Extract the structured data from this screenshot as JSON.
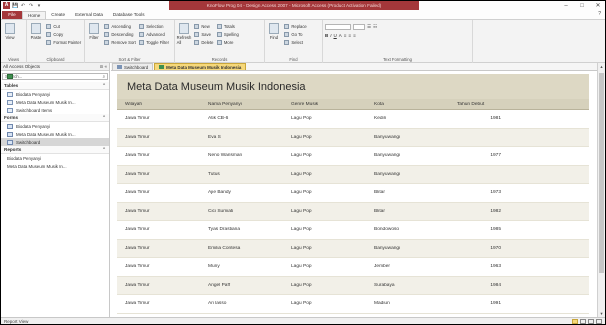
{
  "title_bar": {
    "app_icon_glyph": "A",
    "tools_text": "KnoFlow Prog 04 - Design Access 2007 - Microsoft Access (Product Activation Failed)",
    "window_controls": [
      "–",
      "□",
      "✕"
    ],
    "qat_glyphs": [
      "💾",
      "↶",
      "↷",
      "▾"
    ]
  },
  "tabs": {
    "file": "File",
    "items": [
      "Home",
      "Create",
      "External Data",
      "Database Tools"
    ],
    "active": "Home",
    "help_glyph": "?"
  },
  "ribbon": {
    "views": {
      "label": "Views",
      "view_button": "View"
    },
    "clipboard": {
      "label": "Clipboard",
      "paste": "Paste",
      "cut": "Cut",
      "copy": "Copy",
      "format_painter": "Format Painter"
    },
    "sort_filter": {
      "label": "Sort & Filter",
      "filter": "Filter",
      "ascending": "Ascending",
      "descending": "Descending",
      "remove_sort": "Remove Sort",
      "selection": "Selection",
      "advanced": "Advanced",
      "toggle_filter": "Toggle Filter"
    },
    "records": {
      "label": "Records",
      "refresh": "Refresh All",
      "new": "New",
      "save": "Save",
      "delete": "Delete",
      "totals": "Totals",
      "spelling": "Spelling",
      "more": "More"
    },
    "find": {
      "label": "Find",
      "find_button": "Find",
      "replace": "Replace",
      "go_to": "Go To",
      "select": "Select"
    },
    "text_formatting": {
      "label": "Text Formatting",
      "bold": "B",
      "italic": "I",
      "underline": "U",
      "font_color": "A"
    }
  },
  "nav": {
    "header": "All Access Objects",
    "search_placeholder": "Search...",
    "sections": [
      {
        "title": "Tables",
        "items": [
          "Biodata Penyanyi",
          "Meta Data Museum Musik In...",
          "Switchboard Items"
        ]
      },
      {
        "title": "Forms",
        "items": [
          "Biodata Penyanyi",
          "Meta Data Museum Musik In...",
          "Switchboard"
        ]
      },
      {
        "title": "Reports",
        "items": [
          "Biodata Penyanyi",
          "Meta Data Museum Musik In..."
        ]
      }
    ]
  },
  "doc_tabs": [
    {
      "label": "Switchboard",
      "active": false
    },
    {
      "label": "Meta Data Museum Musik Indonesia",
      "active": true
    }
  ],
  "report": {
    "title": "Meta Data Museum Musik Indonesia",
    "columns": [
      "Wilayah",
      "Nama Penyanyi",
      "Genre Musik",
      "Kota",
      "Tahun Debut"
    ],
    "rows": [
      [
        "Jawa Timur",
        "Atik CB-6",
        "Lagu Pop",
        "Kediri",
        "1981"
      ],
      [
        "Jawa Timur",
        "Eva S",
        "Lagu Pop",
        "Banyuwangi",
        ""
      ],
      [
        "Jawa Timur",
        "Neno Warisman",
        "Lagu Pop",
        "Banyuwangi",
        "1977"
      ],
      [
        "Jawa Timur",
        "Tutus",
        "Lagu Pop",
        "Banyuwangi",
        ""
      ],
      [
        "Jawa Timur",
        "Ajie Bandy",
        "Lagu Pop",
        "Blitar",
        "1973"
      ],
      [
        "Jawa Timur",
        "Cici Sumiati",
        "Lagu Pop",
        "Blitar",
        "1982"
      ],
      [
        "Jawa Timur",
        "Tyas Drastiana",
        "Lagu Pop",
        "Bondowoso",
        "1985"
      ],
      [
        "Jawa Timur",
        "Emilia Contesa",
        "Lagu Pop",
        "Banyuwangi",
        "1970"
      ],
      [
        "Jawa Timur",
        "Muny",
        "Lagu Pop",
        "Jember",
        "1963"
      ],
      [
        "Jawa Timur",
        "Angel Paff",
        "Lagu Pop",
        "Surabaya",
        "1984"
      ],
      [
        "Jawa Timur",
        "Ari lasso",
        "Lagu Pop",
        "Madiun",
        "1991"
      ]
    ]
  },
  "status_bar": {
    "text": "Report View"
  }
}
